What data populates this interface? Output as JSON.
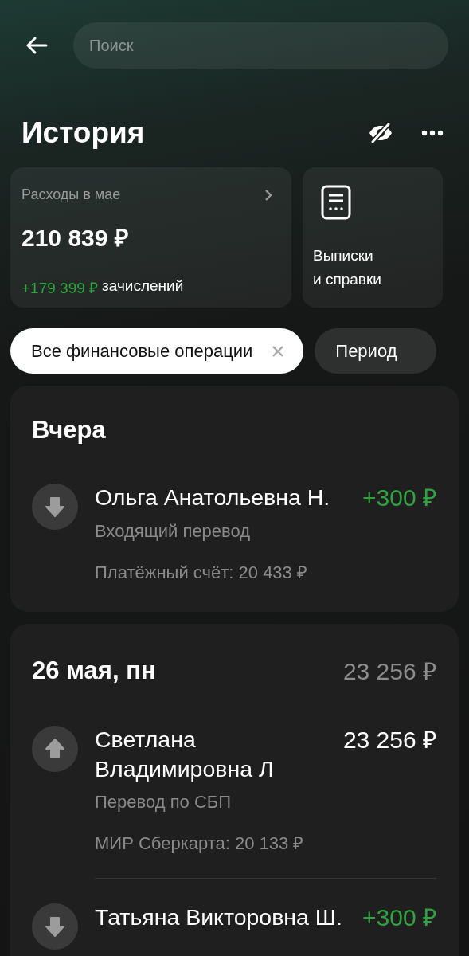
{
  "search": {
    "placeholder": "Поиск"
  },
  "title": "История",
  "expenses_card": {
    "label": "Расходы в мае",
    "amount": "210 839 ₽",
    "income_amount": "+179 399 ₽",
    "income_label": "зачислений"
  },
  "statements_card": {
    "label_lines": [
      "Выписки",
      "и справки"
    ]
  },
  "filters": [
    {
      "label": "Все финансовые операции",
      "selected": true
    },
    {
      "label": "Период",
      "selected": false
    }
  ],
  "days": [
    {
      "title": "Вчера",
      "transactions": [
        {
          "name": "Ольга Анатольевна Н.",
          "amount": "+300 ₽",
          "incoming": true,
          "description": "Входящий перевод",
          "account": "Платёжный счёт: 20 433 ₽"
        }
      ]
    },
    {
      "title": "26 мая, пн",
      "total": "23 256 ₽",
      "transactions": [
        {
          "name": "Светлана Владимировна Л",
          "amount": "23 256 ₽",
          "incoming": false,
          "description": "Перевод по СБП",
          "account": "МИР Сберкарта: 20 133 ₽"
        },
        {
          "name": "Татьяна Викторовна Ш.",
          "amount": "+300 ₽",
          "incoming": true
        }
      ]
    }
  ]
}
